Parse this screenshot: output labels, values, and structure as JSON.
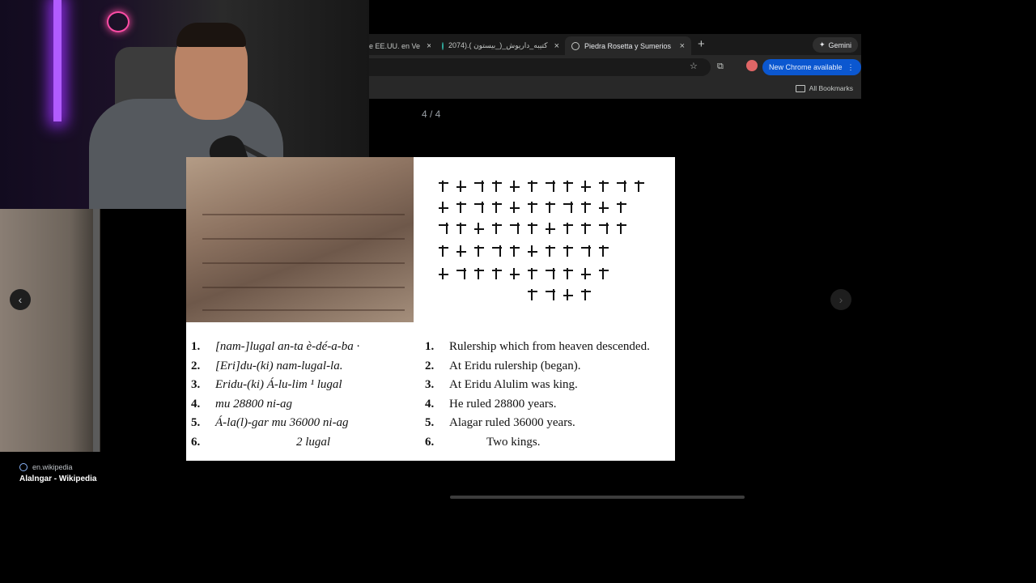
{
  "browser": {
    "tabs": [
      {
        "label": "e EE.UU. en Ve",
        "active": false
      },
      {
        "label": "2074).( کتیبه_داریوش_(_بیستون",
        "active": false
      },
      {
        "label": "Piedra Rosetta y Sumerios",
        "active": true
      }
    ],
    "new_tab": "+",
    "gemini_label": "Gemini",
    "new_chrome_label": "New Chrome available",
    "all_bookmarks_label": "All Bookmarks"
  },
  "viewer": {
    "counter": "4 / 4",
    "prev_icon": "chevron-left-icon",
    "next_icon": "chevron-right-icon"
  },
  "sidebar_result": {
    "source": "en.wikipedia",
    "title": "Alalngar - Wikipedia"
  },
  "document": {
    "transliteration": [
      {
        "num": "1.",
        "text": "[nam-]lugal an-ta è-dé-a-ba ·"
      },
      {
        "num": "2.",
        "text": "[Eri]du-(ki) nam-lugal-la."
      },
      {
        "num": "3.",
        "text": "Eridu-(ki) Á-lu-lim ¹ lugal"
      },
      {
        "num": "4.",
        "text": "mu 28800 ni-ag"
      },
      {
        "num": "5.",
        "text": "Á-la(l)-gar mu 36000 ni-ag"
      },
      {
        "num": "6.",
        "text": "2 lugal"
      }
    ],
    "translation": [
      {
        "num": "1.",
        "text": "Rulership which from heaven descended."
      },
      {
        "num": "2.",
        "text": "At Eridu rulership (began)."
      },
      {
        "num": "3.",
        "text": "At Eridu Alulim was king."
      },
      {
        "num": "4.",
        "text": "He ruled 28800 years."
      },
      {
        "num": "5.",
        "text": "Alagar ruled 36000 years."
      },
      {
        "num": "6.",
        "text": "Two kings."
      }
    ]
  }
}
